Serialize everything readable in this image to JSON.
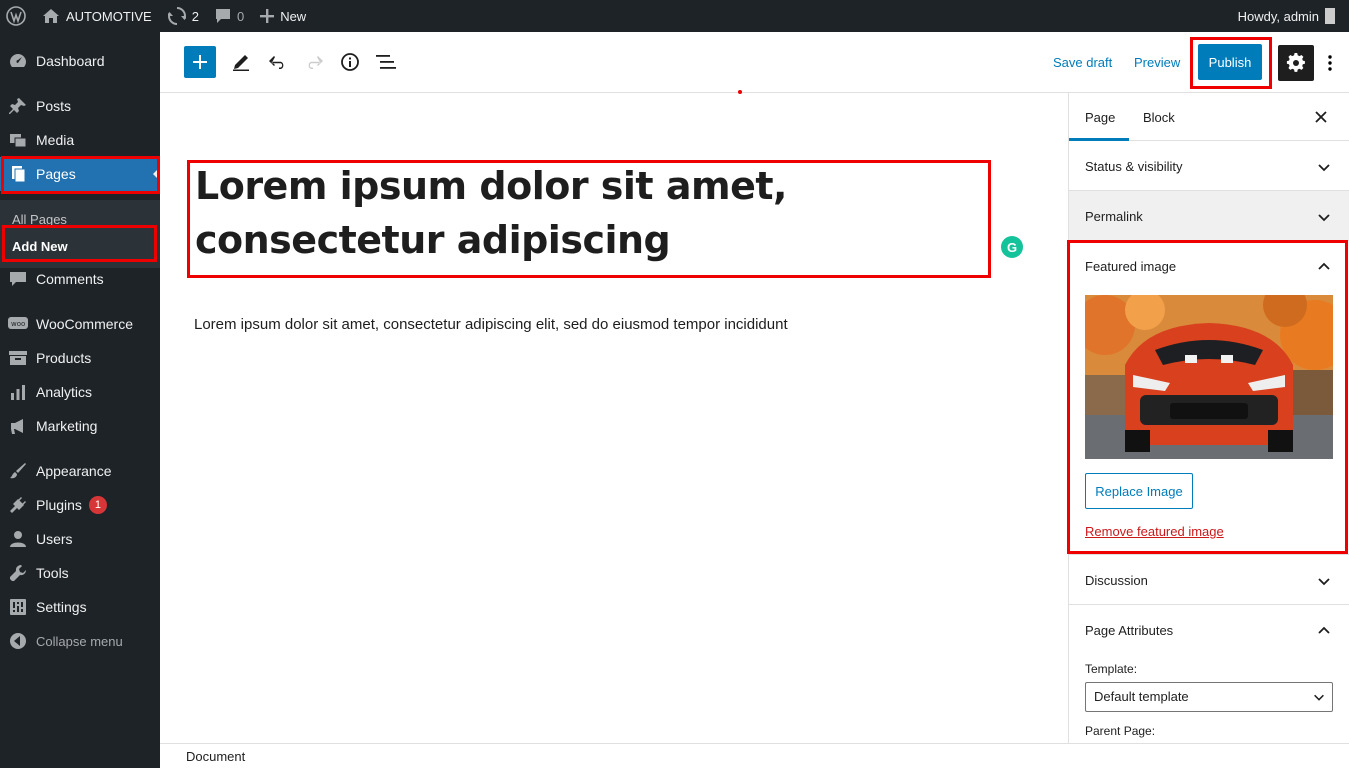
{
  "adminbar": {
    "site_name": "AUTOMOTIVE",
    "updates_count": "2",
    "comments_count": "0",
    "new_label": "New",
    "greeting": "Howdy, admin"
  },
  "sidebar": {
    "items": [
      {
        "label": "Dashboard",
        "icon": "dashboard-icon"
      },
      {
        "label": "Posts",
        "icon": "pushpin-icon"
      },
      {
        "label": "Media",
        "icon": "media-icon"
      },
      {
        "label": "Pages",
        "icon": "pages-icon"
      },
      {
        "label": "Comments",
        "icon": "comment-icon"
      },
      {
        "label": "WooCommerce",
        "icon": "woocommerce-icon"
      },
      {
        "label": "Products",
        "icon": "archive-icon"
      },
      {
        "label": "Analytics",
        "icon": "bar-chart-icon"
      },
      {
        "label": "Marketing",
        "icon": "megaphone-icon"
      },
      {
        "label": "Appearance",
        "icon": "paintbrush-icon"
      },
      {
        "label": "Plugins",
        "icon": "plug-icon"
      },
      {
        "label": "Users",
        "icon": "user-icon"
      },
      {
        "label": "Tools",
        "icon": "wrench-icon"
      },
      {
        "label": "Settings",
        "icon": "settings-icon"
      }
    ],
    "plugins_badge": "1",
    "submenu": {
      "all_pages": "All Pages",
      "add_new": "Add New"
    },
    "collapse": "Collapse menu"
  },
  "toolbar": {
    "save_draft": "Save draft",
    "preview": "Preview",
    "publish": "Publish"
  },
  "editor": {
    "title": "Lorem ipsum dolor sit amet, consectetur adipiscing",
    "paragraph": "Lorem ipsum dolor sit amet, consectetur adipiscing elit, sed do eiusmod tempor incididunt"
  },
  "footer": {
    "breadcrumb": "Document"
  },
  "panel": {
    "tabs": [
      "Page",
      "Block"
    ],
    "active_tab": "Page",
    "sections": {
      "status": "Status & visibility",
      "permalink": "Permalink",
      "featured": "Featured image",
      "discussion": "Discussion",
      "attributes": "Page Attributes"
    },
    "replace_image": "Replace Image",
    "remove_image": "Remove featured image",
    "template_label": "Template:",
    "template_value": "Default template",
    "parent_label": "Parent Page:"
  },
  "colors": {
    "admin_bg": "#1d2327",
    "accent": "#007cba",
    "current_menu": "#2271b1",
    "highlight": "#e00000"
  }
}
